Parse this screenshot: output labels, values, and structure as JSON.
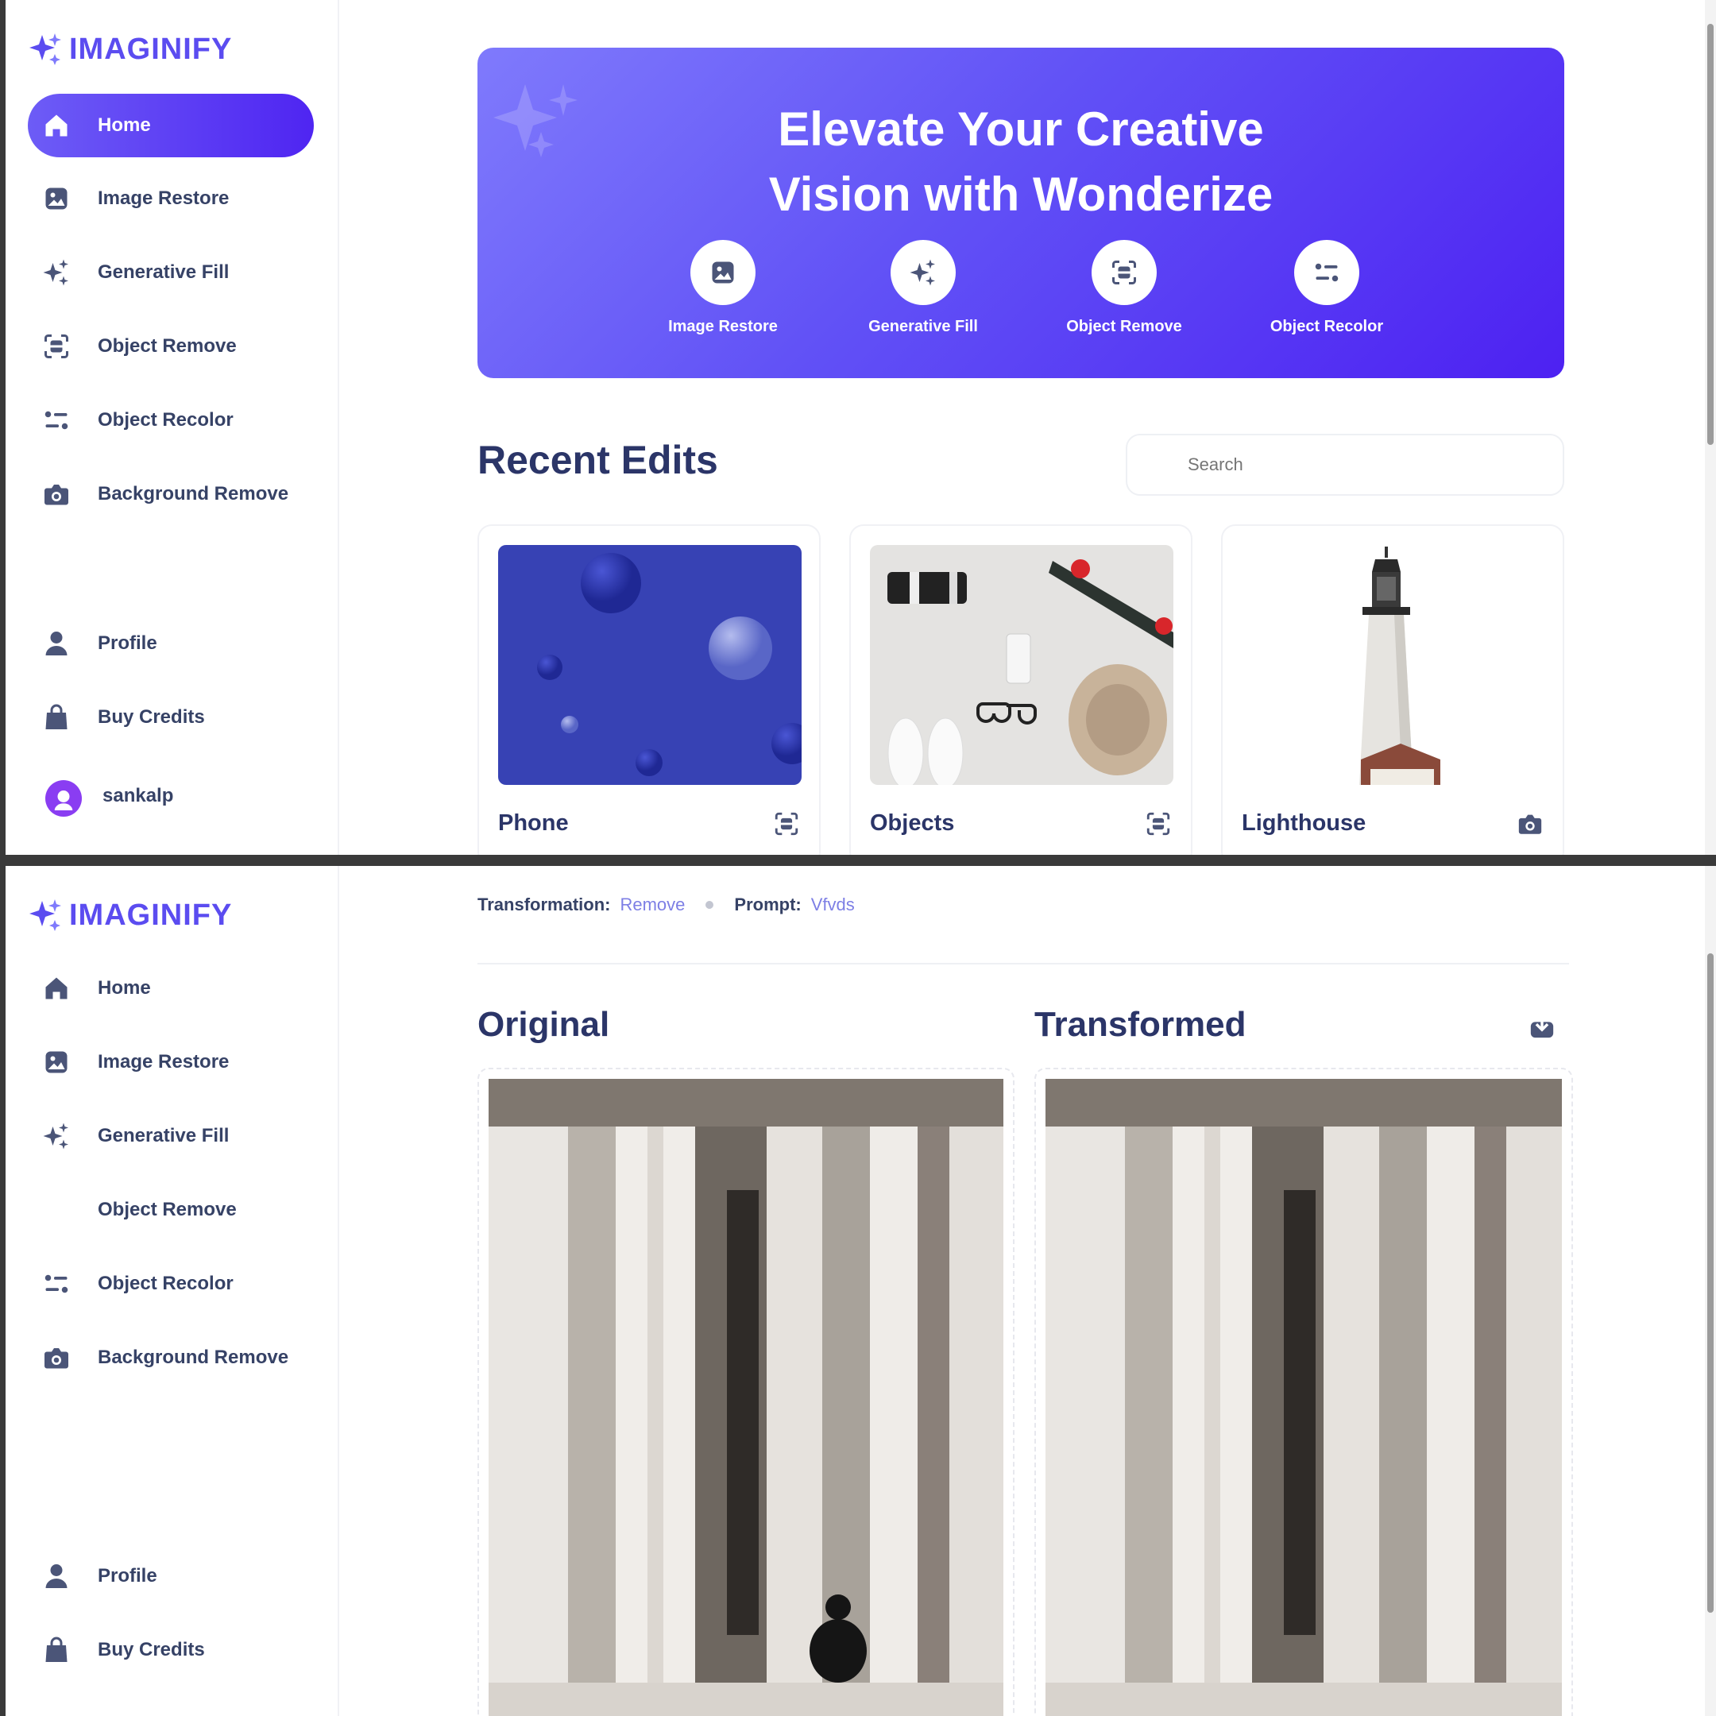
{
  "brand": {
    "name": "IMAGINIFY"
  },
  "nav": {
    "items": [
      {
        "label": "Home",
        "icon": "home-icon"
      },
      {
        "label": "Image Restore",
        "icon": "image-icon"
      },
      {
        "label": "Generative Fill",
        "icon": "stars-icon"
      },
      {
        "label": "Object Remove",
        "icon": "scan-icon"
      },
      {
        "label": "Object Recolor",
        "icon": "filter-icon"
      },
      {
        "label": "Background Remove",
        "icon": "camera-icon"
      }
    ],
    "bottom": [
      {
        "label": "Profile",
        "icon": "user-icon"
      },
      {
        "label": "Buy Credits",
        "icon": "bag-icon"
      }
    ],
    "user": {
      "name": "sankalp"
    }
  },
  "home": {
    "banner_line1": "Elevate Your Creative",
    "banner_line2": "Vision with Wonderize",
    "actions": [
      {
        "label": "Image Restore"
      },
      {
        "label": "Generative Fill"
      },
      {
        "label": "Object Remove"
      },
      {
        "label": "Object Recolor"
      }
    ],
    "recent_title": "Recent Edits",
    "search_placeholder": "Search",
    "cards": [
      {
        "title": "Phone",
        "icon": "scan-icon"
      },
      {
        "title": "Objects",
        "icon": "scan-icon"
      },
      {
        "title": "Lighthouse",
        "icon": "camera-icon"
      }
    ]
  },
  "detail": {
    "transformation_label": "Transformation:",
    "transformation_value": "Remove",
    "prompt_label": "Prompt:",
    "prompt_value": "Vfvds",
    "original_title": "Original",
    "transformed_title": "Transformed"
  },
  "colors": {
    "accent": "#5b4cf0",
    "banner_start": "#7f7afc",
    "banner_end": "#4d21f2",
    "text_dark": "#2b3568"
  }
}
